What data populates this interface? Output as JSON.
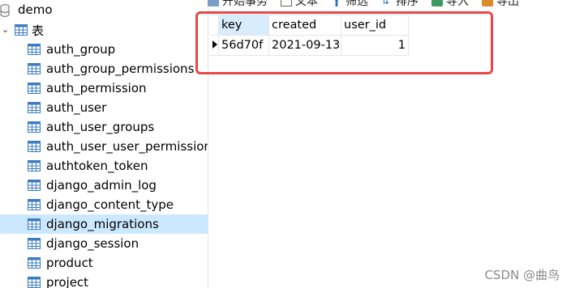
{
  "toolbar": {
    "items": [
      {
        "label": "开始事务"
      },
      {
        "label": "文本"
      },
      {
        "label": "筛选"
      },
      {
        "label": "排序"
      },
      {
        "label": "导入"
      },
      {
        "label": "导出"
      }
    ]
  },
  "sidebar": {
    "database": "demo",
    "group": "表",
    "tables": [
      "auth_group",
      "auth_group_permissions",
      "auth_permission",
      "auth_user",
      "auth_user_groups",
      "auth_user_user_permissions",
      "authtoken_token",
      "django_admin_log",
      "django_content_type",
      "django_migrations",
      "django_session",
      "product",
      "project"
    ],
    "selected_index": 9
  },
  "grid": {
    "columns": [
      "key",
      "created",
      "user_id"
    ],
    "rows": [
      {
        "key": "56d70f",
        "created": "2021-09-13",
        "user_id": "1"
      }
    ]
  },
  "colors": {
    "selected_row": "#cce8ff",
    "highlight_box": "#e8474b",
    "header_highlight": "#d9ecfb"
  },
  "watermark": "CSDN @曲鸟"
}
